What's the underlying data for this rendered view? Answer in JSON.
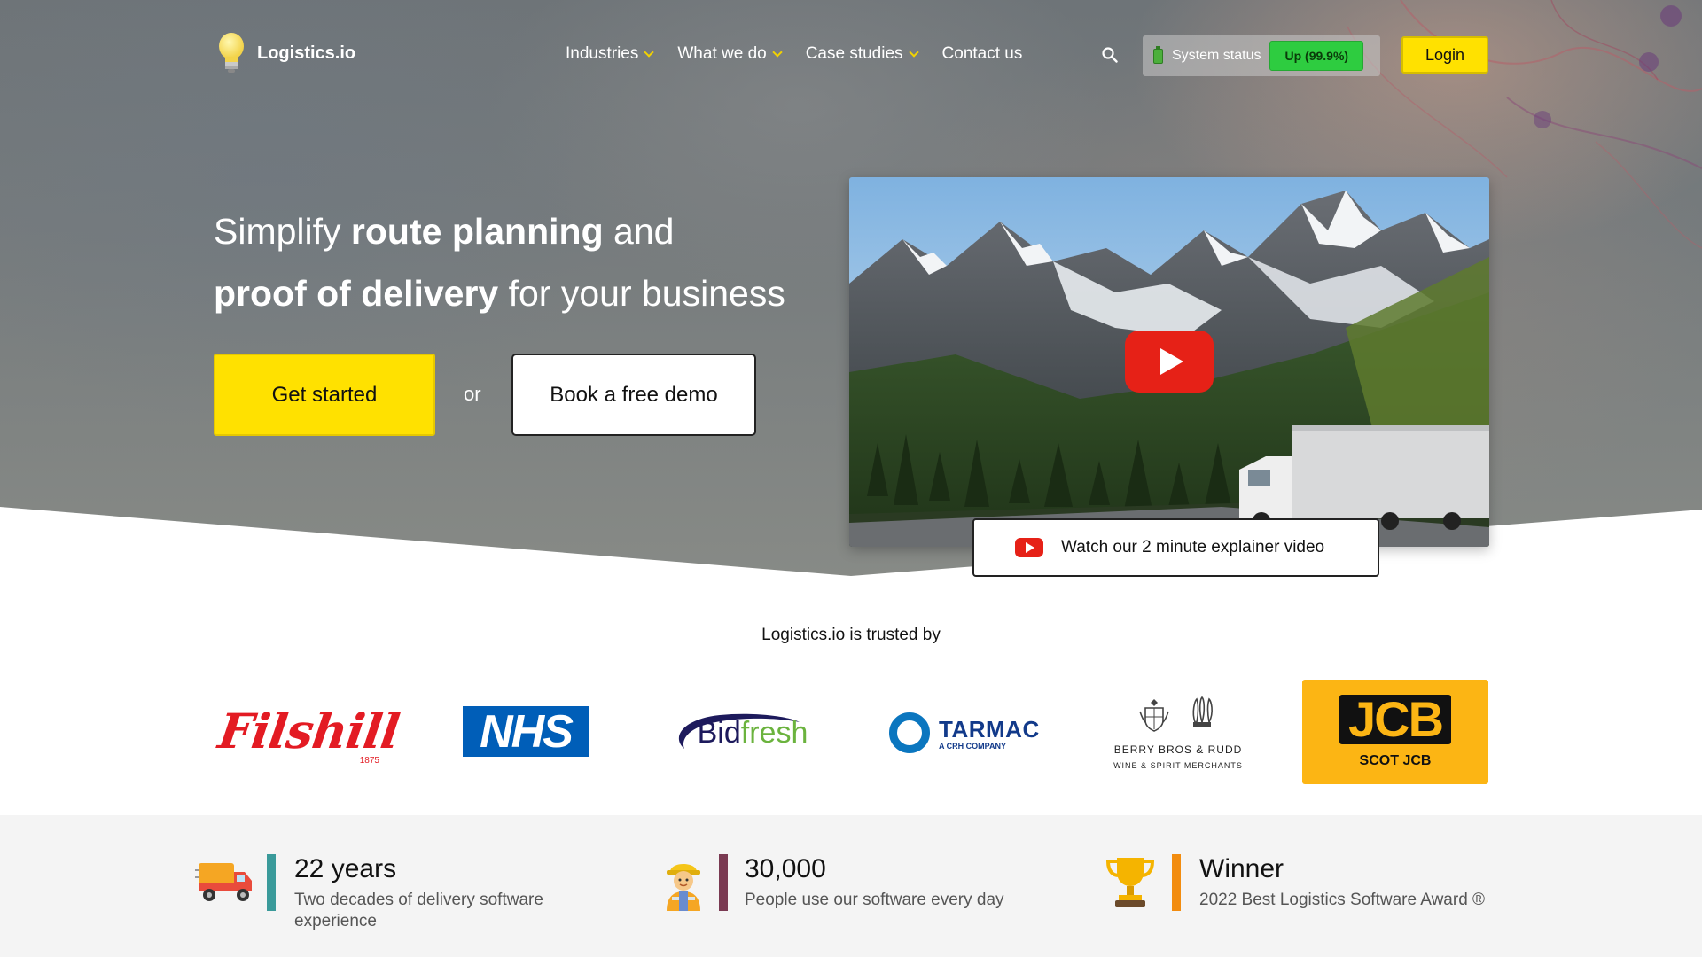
{
  "brand": {
    "name": "Logistics.io"
  },
  "nav": {
    "items": [
      {
        "label": "Industries",
        "dropdown": true
      },
      {
        "label": "What we do",
        "dropdown": true
      },
      {
        "label": "Case studies",
        "dropdown": true
      },
      {
        "label": "Contact us",
        "dropdown": false
      }
    ],
    "search_icon": "search-icon",
    "status": {
      "label": "System status",
      "badge": "Up (99.9%)",
      "badge_color": "#2ecc40"
    },
    "login_label": "Login"
  },
  "hero": {
    "headline": {
      "part1": "Simplify ",
      "bold1": "route planning",
      "part2": " and",
      "bold2": "proof of delivery",
      "part3": " for your business"
    },
    "primary_cta": "Get started",
    "separator": "or",
    "secondary_cta": "Book a free demo",
    "video_cta": "Watch our 2 minute explainer video"
  },
  "trusted": {
    "title": "Logistics.io is trusted by",
    "logos": [
      {
        "name": "Filshill",
        "sub": "1875"
      },
      {
        "name": "NHS"
      },
      {
        "name": "Bid",
        "name2": "fresh"
      },
      {
        "name": "TARMAC",
        "sub": "A CRH COMPANY"
      },
      {
        "name": "BERRY BROS & RUDD",
        "sub": "WINE & SPIRIT MERCHANTS"
      },
      {
        "name": "JCB",
        "sub": "SCOT JCB"
      }
    ]
  },
  "stats": [
    {
      "icon": "delivery-truck-icon",
      "title": "22 years",
      "desc_line1": "Two decades of delivery software",
      "desc_line2": "experience",
      "bar_color": "#3a9a9a"
    },
    {
      "icon": "worker-icon",
      "title": "30,000",
      "desc_line1": "People use our software every day",
      "desc_line2": "",
      "bar_color": "#7a3a52"
    },
    {
      "icon": "trophy-icon",
      "title": "Winner",
      "desc_line1": "2022 Best Logistics Software Award ®",
      "desc_line2": "",
      "bar_color": "#f28c0f"
    }
  ],
  "colors": {
    "accent": "#ffe100",
    "dark": "#111111"
  }
}
